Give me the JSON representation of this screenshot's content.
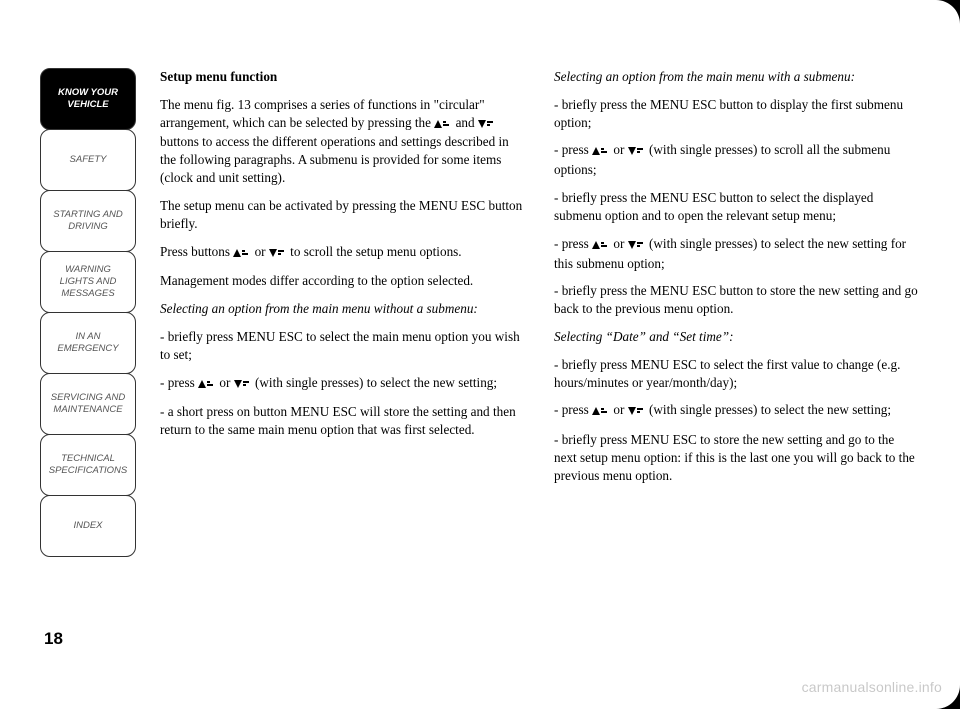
{
  "tabs": [
    {
      "label": "KNOW YOUR VEHICLE",
      "active": true
    },
    {
      "label": "SAFETY",
      "active": false
    },
    {
      "label": "STARTING AND DRIVING",
      "active": false
    },
    {
      "label": "WARNING LIGHTS AND MESSAGES",
      "active": false
    },
    {
      "label": "IN AN EMERGENCY",
      "active": false
    },
    {
      "label": "SERVICING AND MAINTENANCE",
      "active": false
    },
    {
      "label": "TECHNICAL SPECIFICATIONS",
      "active": false
    },
    {
      "label": "INDEX",
      "active": false
    }
  ],
  "left": {
    "heading": "Setup menu function",
    "p1a": "The menu fig. 13 comprises a series of functions in \"circular\" arrangement, which can be selected by pressing the ",
    "p1b": " and ",
    "p1c": " buttons to access the different operations and settings described in the following paragraphs. A submenu is provided for some items (clock and unit setting).",
    "p2": "The setup menu can be activated by pressing the MENU ESC button briefly.",
    "p3a": "Press buttons ",
    "p3b": " or ",
    "p3c": " to scroll the setup menu options.",
    "p4": "Management modes differ according to the option selected.",
    "p5": "Selecting an option from the main menu without a submenu:",
    "p6": "- briefly press MENU ESC to select the main menu option you wish to set;",
    "p7a": "- press ",
    "p7b": " or ",
    "p7c": " (with single presses) to select the new setting;",
    "p8": "- a short press on button MENU ESC will store the setting and then return to the same main menu option that was first selected."
  },
  "right": {
    "p1": "Selecting an option from the main menu with a submenu:",
    "p2": "- briefly press the MENU ESC button to display the first submenu option;",
    "p3a": "- press ",
    "p3b": " or ",
    "p3c": " (with single presses) to scroll all the submenu options;",
    "p4": "- briefly press the MENU ESC button to select the displayed submenu option and to open the relevant setup menu;",
    "p5a": "- press ",
    "p5b": " or ",
    "p5c": " (with single presses) to select the new setting for this submenu option;",
    "p6": "- briefly press the MENU ESC button to store the new setting and go back to the previous menu option.",
    "p7": "Selecting “Date” and “Set time”:",
    "p8": "- briefly press MENU ESC to select the first value to change (e.g. hours/minutes or year/month/day);",
    "p9a": "- press ",
    "p9b": " or ",
    "p9c": " (with single presses) to select the new setting;",
    "p10": "- briefly press MENU ESC to store the new setting and go to the next setup menu option: if this is the last one you will go back to the previous menu option."
  },
  "page_number": "18",
  "watermark": "carmanualsonline.info"
}
